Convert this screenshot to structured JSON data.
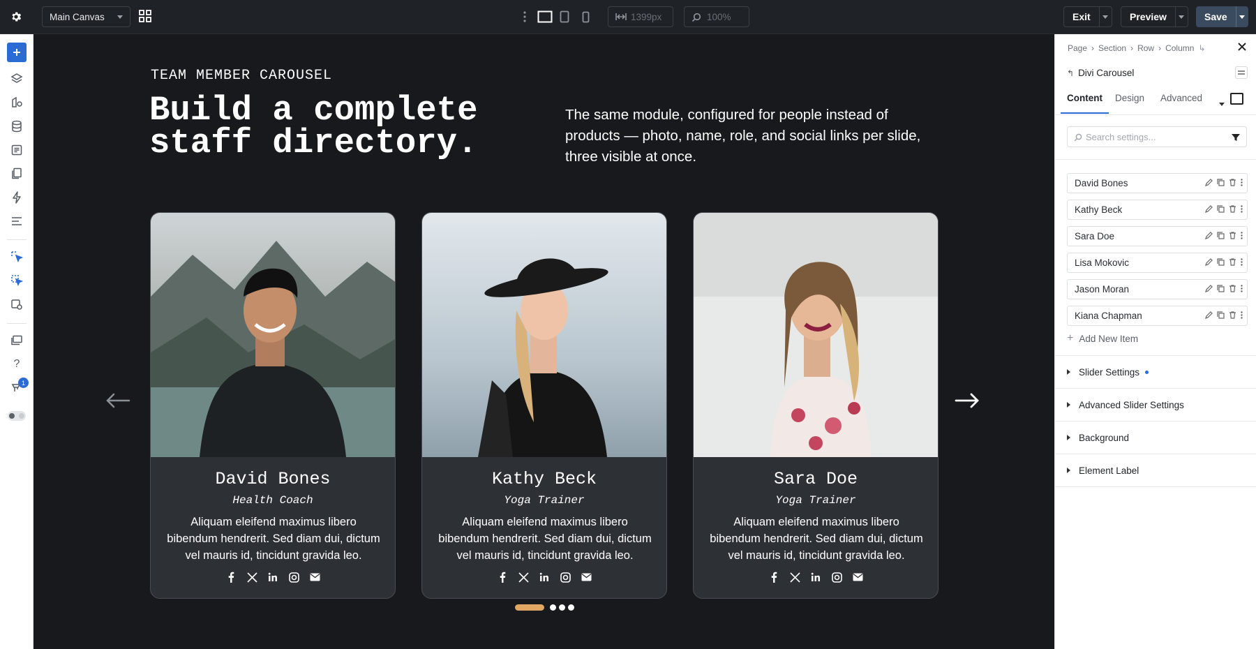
{
  "topbar": {
    "canvas_select": "Main Canvas",
    "width_value": "1399px",
    "zoom_value": "100%",
    "exit_label": "Exit",
    "preview_label": "Preview",
    "save_label": "Save",
    "colors": {
      "bar": "#1f2226",
      "save": "#3a4b5f"
    }
  },
  "leftbar": {
    "notification_count": "1",
    "accent": "#2b6cd4"
  },
  "canvas": {
    "eyebrow": "TEAM MEMBER CAROUSEL",
    "headline_line1": "Build a complete",
    "headline_line2": "staff directory.",
    "intro": "The same module, configured for people instead of products — photo, name, role, and social links per slide, three visible at once.",
    "cards": [
      {
        "name": "David Bones",
        "role": "Health Coach",
        "bio": "Aliquam eleifend maximus libero bibendum hendrerit. Sed diam dui, dictum vel mauris id, tincidunt gravida leo."
      },
      {
        "name": "Kathy Beck",
        "role": "Yoga Trainer",
        "bio": "Aliquam eleifend maximus libero bibendum hendrerit. Sed diam dui, dictum vel mauris id, tincidunt gravida leo."
      },
      {
        "name": "Sara Doe",
        "role": "Yoga Trainer",
        "bio": "Aliquam eleifend maximus libero bibendum hendrerit. Sed diam dui, dictum vel mauris id, tincidunt gravida leo."
      }
    ],
    "social_icons": [
      "facebook-icon",
      "x-icon",
      "linkedin-icon",
      "instagram-icon",
      "email-icon"
    ],
    "dot_active_color": "#e0a662"
  },
  "panel": {
    "breadcrumb": [
      "Page",
      "Section",
      "Row",
      "Column"
    ],
    "module_name": "Divi Carousel",
    "tabs": [
      "Content",
      "Design",
      "Advanced"
    ],
    "search_placeholder": "Search settings...",
    "items": [
      "David Bones",
      "Kathy Beck",
      "Sara Doe",
      "Lisa Mokovic",
      "Jason Moran",
      "Kiana Chapman"
    ],
    "add_item_label": "Add New Item",
    "sections": [
      "Slider Settings",
      "Advanced Slider Settings",
      "Background",
      "Element Label"
    ]
  }
}
